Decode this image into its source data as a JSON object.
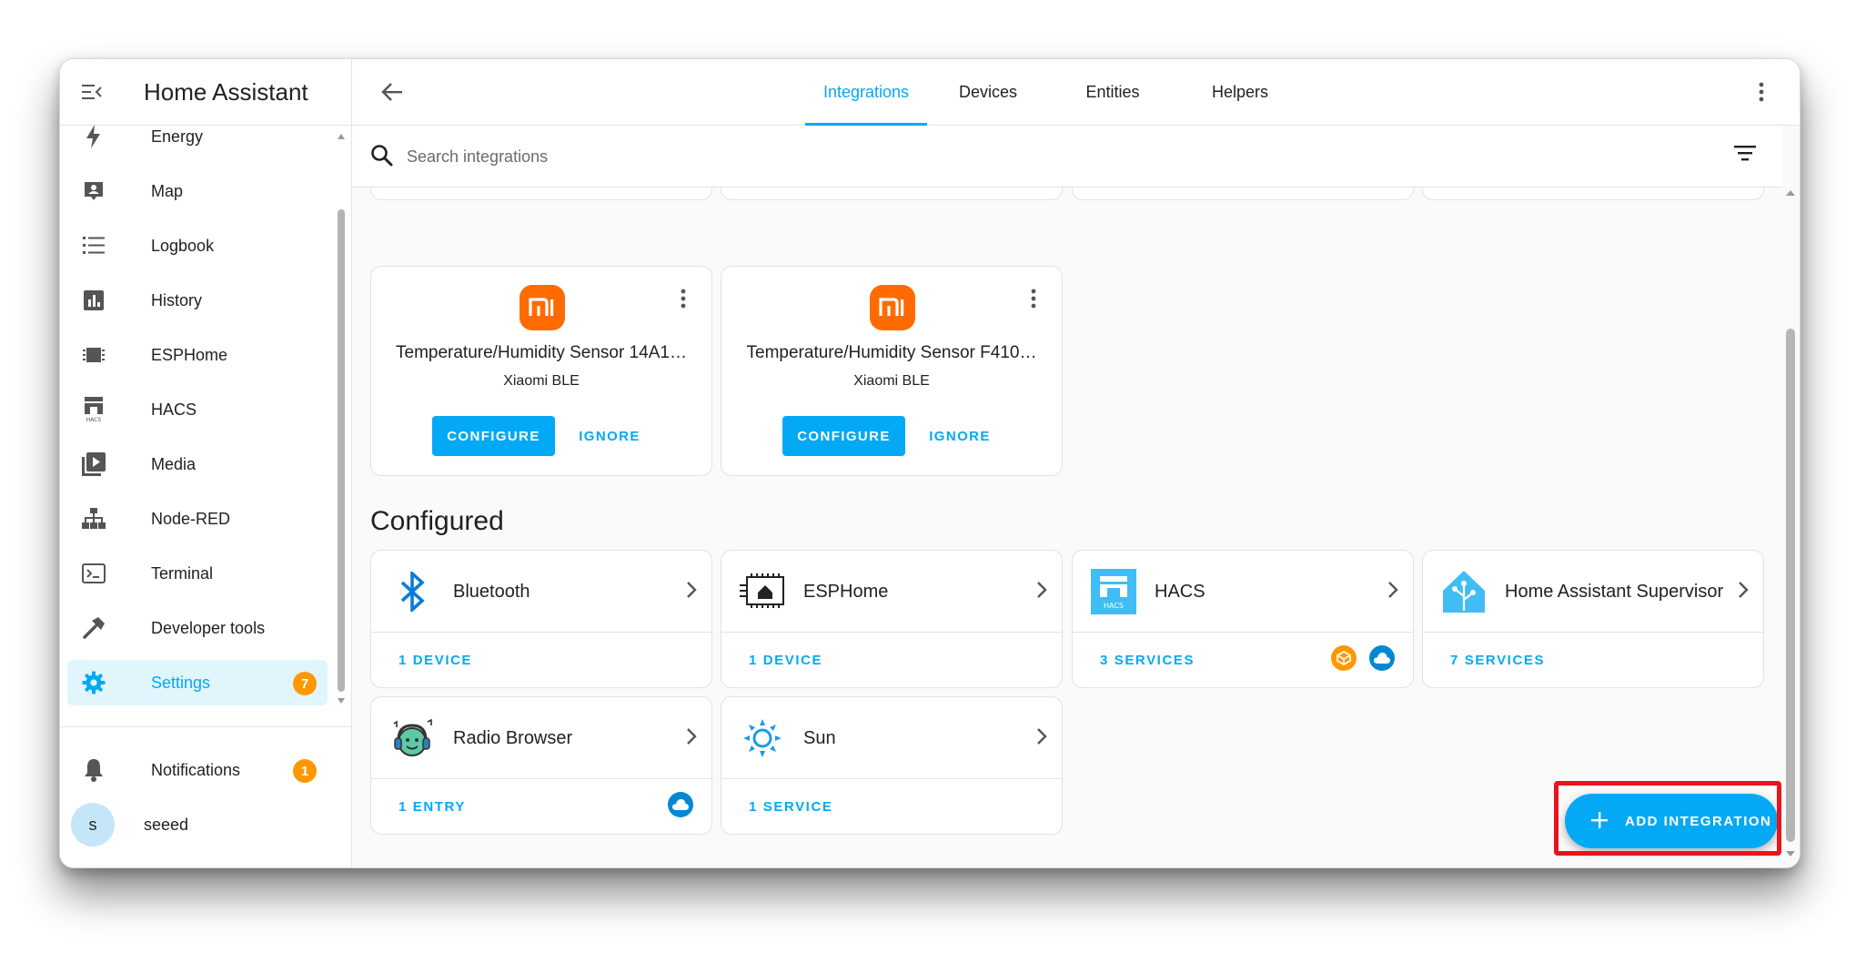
{
  "app": {
    "title": "Home Assistant"
  },
  "sidebar": {
    "items": [
      {
        "label": "Energy",
        "icon": "flash-icon"
      },
      {
        "label": "Map",
        "icon": "map-person-icon"
      },
      {
        "label": "Logbook",
        "icon": "list-icon"
      },
      {
        "label": "History",
        "icon": "chart-icon"
      },
      {
        "label": "ESPHome",
        "icon": "chip-icon"
      },
      {
        "label": "HACS",
        "icon": "hacs-icon"
      },
      {
        "label": "Media",
        "icon": "media-icon"
      },
      {
        "label": "Node-RED",
        "icon": "sitemap-icon"
      },
      {
        "label": "Terminal",
        "icon": "terminal-icon"
      },
      {
        "label": "Developer tools",
        "icon": "hammer-icon"
      },
      {
        "label": "Settings",
        "icon": "gear-icon",
        "badge": "7",
        "active": true
      }
    ],
    "notifications": {
      "label": "Notifications",
      "badge": "1"
    },
    "user": {
      "name": "seeed",
      "initial": "s"
    }
  },
  "tabs": [
    {
      "label": "Integrations",
      "active": true
    },
    {
      "label": "Devices"
    },
    {
      "label": "Entities"
    },
    {
      "label": "Helpers"
    }
  ],
  "search": {
    "placeholder": "Search integrations"
  },
  "discovered": [
    {
      "title": "Temperature/Humidity Sensor 14A1…",
      "subtitle": "Xiaomi BLE",
      "configure_label": "CONFIGURE",
      "ignore_label": "IGNORE"
    },
    {
      "title": "Temperature/Humidity Sensor F410…",
      "subtitle": "Xiaomi BLE",
      "configure_label": "CONFIGURE",
      "ignore_label": "IGNORE"
    }
  ],
  "configured": {
    "title": "Configured",
    "cards": [
      {
        "name": "Bluetooth",
        "count": "1 DEVICE",
        "icon": "bluetooth-icon"
      },
      {
        "name": "ESPHome",
        "count": "1 DEVICE",
        "icon": "esphome-icon"
      },
      {
        "name": "HACS",
        "count": "3 SERVICES",
        "icon": "hacs-icon"
      },
      {
        "name": "Home Assistant Supervisor",
        "count": "7 SERVICES",
        "icon": "home-assistant-icon"
      },
      {
        "name": "Radio Browser",
        "count": "1 ENTRY",
        "icon": "radio-browser-icon"
      },
      {
        "name": "Sun",
        "count": "1 SERVICE",
        "icon": "sun-icon"
      }
    ]
  },
  "fab": {
    "label": "ADD INTEGRATION"
  },
  "colors": {
    "accent": "#03a9f4",
    "badge": "#ff9800",
    "xiaomi": "#ff6b00",
    "highlight": "#e8141b",
    "custom_badge": "#ff9800"
  }
}
